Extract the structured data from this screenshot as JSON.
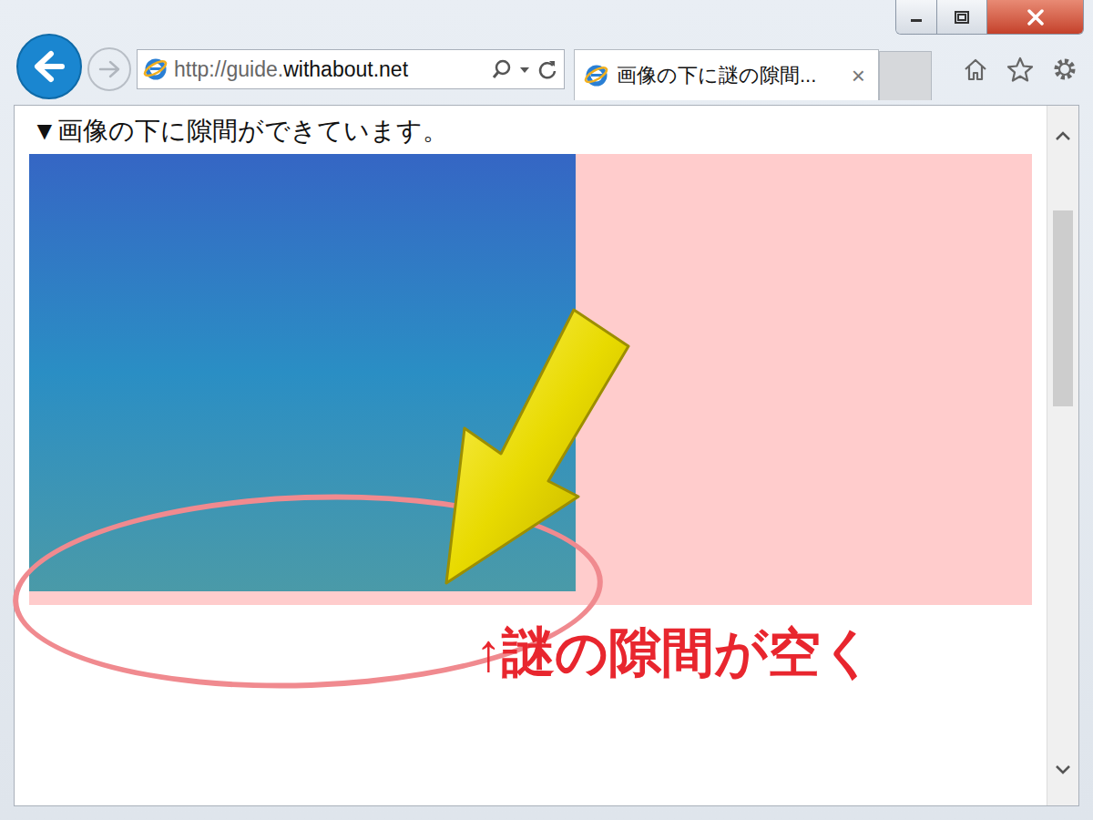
{
  "address_bar": {
    "url_prefix": "http://guide.",
    "url_domain": "withabout.net"
  },
  "tabs": [
    {
      "label": "画像の下に謎の隙間...",
      "selected": true,
      "close": "×"
    }
  ],
  "page": {
    "heading": "▼画像の下に隙間ができています。"
  },
  "annotation": {
    "text": "↑謎の隙間が空く"
  }
}
